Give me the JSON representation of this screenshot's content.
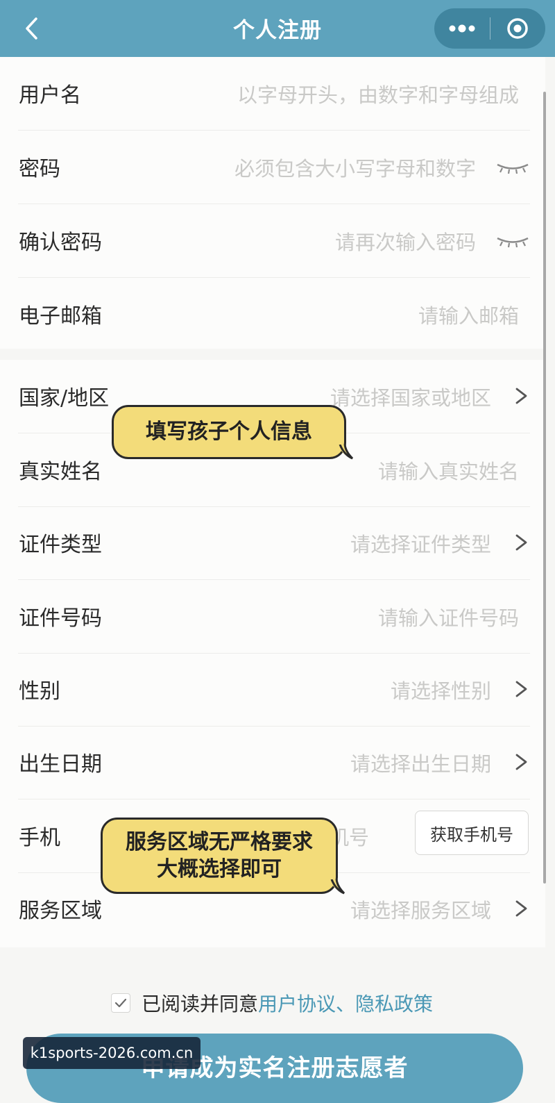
{
  "nav": {
    "title": "个人注册"
  },
  "account_fields": [
    {
      "label": "用户名",
      "placeholder": "以字母开头，由数字和字母组成"
    },
    {
      "label": "密码",
      "placeholder": "必须包含大小写字母和数字"
    },
    {
      "label": "确认密码",
      "placeholder": "请再次输入密码"
    },
    {
      "label": "电子邮箱",
      "placeholder": "请输入邮箱"
    }
  ],
  "profile_fields": [
    {
      "label": "国家/地区",
      "placeholder": "请选择国家或地区"
    },
    {
      "label": "真实姓名",
      "placeholder": "请输入真实姓名"
    },
    {
      "label": "证件类型",
      "placeholder": "请选择证件类型"
    },
    {
      "label": "证件号码",
      "placeholder": "请输入证件号码"
    },
    {
      "label": "性别",
      "placeholder": "请选择性别"
    },
    {
      "label": "出生日期",
      "placeholder": "请选择出生日期"
    },
    {
      "label": "手机",
      "placeholder": "机号"
    },
    {
      "label": "服务区域",
      "placeholder": "请选择服务区域"
    }
  ],
  "get_phone_button": "获取手机号",
  "annotations": {
    "bubble1": "填写孩子个人信息",
    "bubble2_line1": "服务区域无严格要求",
    "bubble2_line2": "大概选择即可"
  },
  "agreement": {
    "checked": true,
    "prefix": "已阅读并同意",
    "link": "用户协议、隐私政策"
  },
  "submit_label": "申请成为实名注册志愿者",
  "watermark": "k1sports-2026.com.cn",
  "colors": {
    "header": "#5ea3bd",
    "link": "#4a98b5",
    "bubble": "#f3dc7a"
  }
}
